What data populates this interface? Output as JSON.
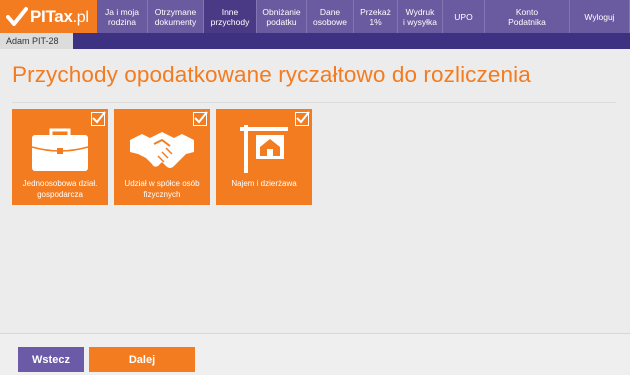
{
  "app": {
    "logo_text": "PITax",
    "logo_suffix": ".pl"
  },
  "nav": [
    {
      "label": "Ja i moja\nrodzina",
      "width": 51,
      "active": false
    },
    {
      "label": "Otrzymane\ndokumenty",
      "width": 56,
      "active": false
    },
    {
      "label": "Inne\nprzychody",
      "width": 53,
      "active": true
    },
    {
      "label": "Obniżanie\npodatku",
      "width": 50,
      "active": false
    },
    {
      "label": "Dane\nosobowe",
      "width": 47,
      "active": false
    },
    {
      "label": "Przekaż\n1%",
      "width": 44,
      "active": false
    },
    {
      "label": "Wydruk\ni wysyłka",
      "width": 45,
      "active": false
    },
    {
      "label": "UPO",
      "width": 42,
      "active": false
    },
    {
      "label": "Konto\nPodatnika",
      "width": 85,
      "active": false
    },
    {
      "label": "Wyloguj",
      "width": 60,
      "active": false
    }
  ],
  "user": {
    "tab_label": "Adam PIT-28"
  },
  "main": {
    "title": "Przychody opodatkowane ryczałtowo do rozliczenia",
    "tiles": [
      {
        "label": "Jednoosobowa dział. gospodarcza",
        "icon": "briefcase-icon",
        "checked": true
      },
      {
        "label": "Udział w spółce osób fizycznych",
        "icon": "handshake-icon",
        "checked": true
      },
      {
        "label": "Najem i dzierżawa",
        "icon": "house-sign-icon",
        "checked": true
      }
    ]
  },
  "footer": {
    "back_label": "Wstecz",
    "next_label": "Dalej"
  },
  "colors": {
    "orange": "#f47c20",
    "purple": "#6a5a9f",
    "dark_purple": "#3d3182"
  }
}
